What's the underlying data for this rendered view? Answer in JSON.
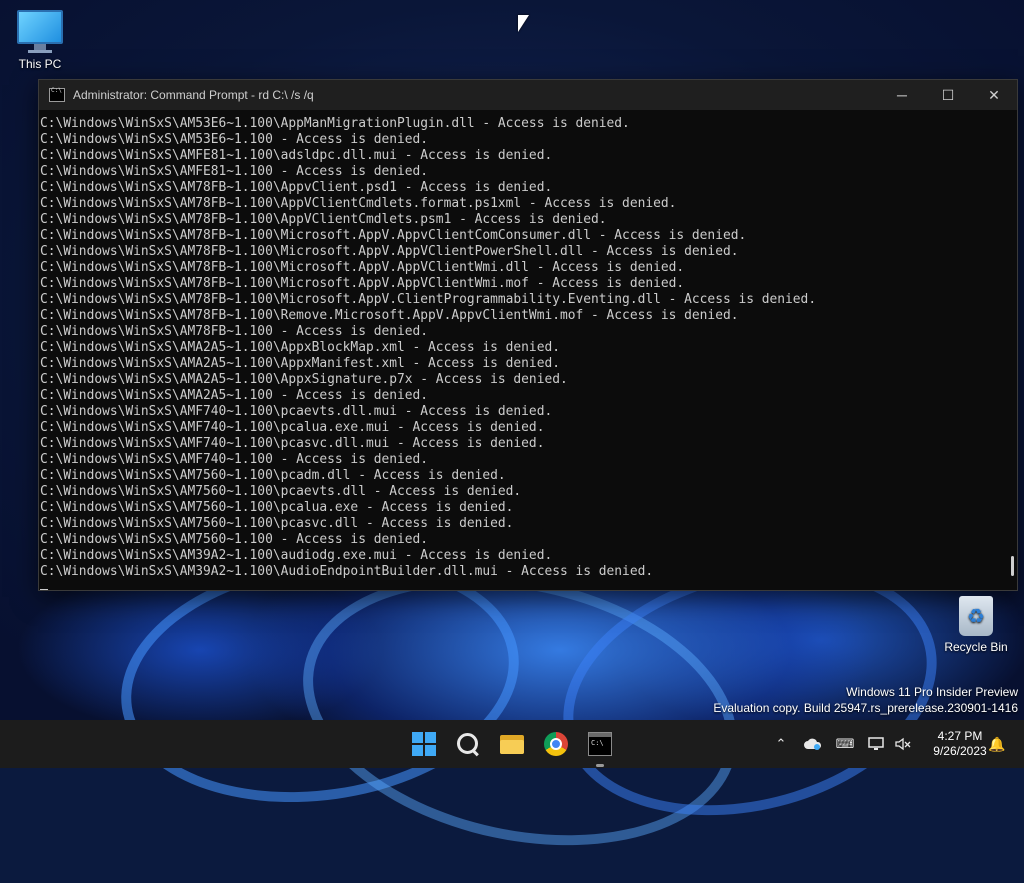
{
  "desktop": {
    "this_pc_label": "This PC",
    "recycle_bin_label": "Recycle Bin"
  },
  "window": {
    "title": "Administrator: Command Prompt - rd  C:\\ /s /q",
    "minimize_glyph": "─",
    "maximize_glyph": "☐",
    "close_glyph": "✕"
  },
  "console": {
    "lines": [
      "C:\\Windows\\WinSxS\\AM53E6~1.100\\AppManMigrationPlugin.dll - Access is denied.",
      "C:\\Windows\\WinSxS\\AM53E6~1.100 - Access is denied.",
      "C:\\Windows\\WinSxS\\AMFE81~1.100\\adsldpc.dll.mui - Access is denied.",
      "C:\\Windows\\WinSxS\\AMFE81~1.100 - Access is denied.",
      "C:\\Windows\\WinSxS\\AM78FB~1.100\\AppvClient.psd1 - Access is denied.",
      "C:\\Windows\\WinSxS\\AM78FB~1.100\\AppVClientCmdlets.format.ps1xml - Access is denied.",
      "C:\\Windows\\WinSxS\\AM78FB~1.100\\AppVClientCmdlets.psm1 - Access is denied.",
      "C:\\Windows\\WinSxS\\AM78FB~1.100\\Microsoft.AppV.AppvClientComConsumer.dll - Access is denied.",
      "C:\\Windows\\WinSxS\\AM78FB~1.100\\Microsoft.AppV.AppVClientPowerShell.dll - Access is denied.",
      "C:\\Windows\\WinSxS\\AM78FB~1.100\\Microsoft.AppV.AppVClientWmi.dll - Access is denied.",
      "C:\\Windows\\WinSxS\\AM78FB~1.100\\Microsoft.AppV.AppVClientWmi.mof - Access is denied.",
      "C:\\Windows\\WinSxS\\AM78FB~1.100\\Microsoft.AppV.ClientProgrammability.Eventing.dll - Access is denied.",
      "C:\\Windows\\WinSxS\\AM78FB~1.100\\Remove.Microsoft.AppV.AppvClientWmi.mof - Access is denied.",
      "C:\\Windows\\WinSxS\\AM78FB~1.100 - Access is denied.",
      "C:\\Windows\\WinSxS\\AMA2A5~1.100\\AppxBlockMap.xml - Access is denied.",
      "C:\\Windows\\WinSxS\\AMA2A5~1.100\\AppxManifest.xml - Access is denied.",
      "C:\\Windows\\WinSxS\\AMA2A5~1.100\\AppxSignature.p7x - Access is denied.",
      "C:\\Windows\\WinSxS\\AMA2A5~1.100 - Access is denied.",
      "C:\\Windows\\WinSxS\\AMF740~1.100\\pcaevts.dll.mui - Access is denied.",
      "C:\\Windows\\WinSxS\\AMF740~1.100\\pcalua.exe.mui - Access is denied.",
      "C:\\Windows\\WinSxS\\AMF740~1.100\\pcasvc.dll.mui - Access is denied.",
      "C:\\Windows\\WinSxS\\AMF740~1.100 - Access is denied.",
      "C:\\Windows\\WinSxS\\AM7560~1.100\\pcadm.dll - Access is denied.",
      "C:\\Windows\\WinSxS\\AM7560~1.100\\pcaevts.dll - Access is denied.",
      "C:\\Windows\\WinSxS\\AM7560~1.100\\pcalua.exe - Access is denied.",
      "C:\\Windows\\WinSxS\\AM7560~1.100\\pcasvc.dll - Access is denied.",
      "C:\\Windows\\WinSxS\\AM7560~1.100 - Access is denied.",
      "C:\\Windows\\WinSxS\\AM39A2~1.100\\audiodg.exe.mui - Access is denied.",
      "C:\\Windows\\WinSxS\\AM39A2~1.100\\AudioEndpointBuilder.dll.mui - Access is denied."
    ]
  },
  "watermark": {
    "line1": "Windows 11 Pro Insider Preview",
    "line2": "Evaluation copy. Build 25947.rs_prerelease.230901-1416"
  },
  "taskbar": {
    "icons": [
      "start-icon",
      "search-icon",
      "file-explorer-icon",
      "chrome-icon",
      "command-prompt-icon"
    ],
    "tray": {
      "chevron_glyph": "⌃",
      "keyboard_glyph": "⌨",
      "notification_glyph": "🔔"
    },
    "time": "4:27 PM",
    "date": "9/26/2023"
  }
}
